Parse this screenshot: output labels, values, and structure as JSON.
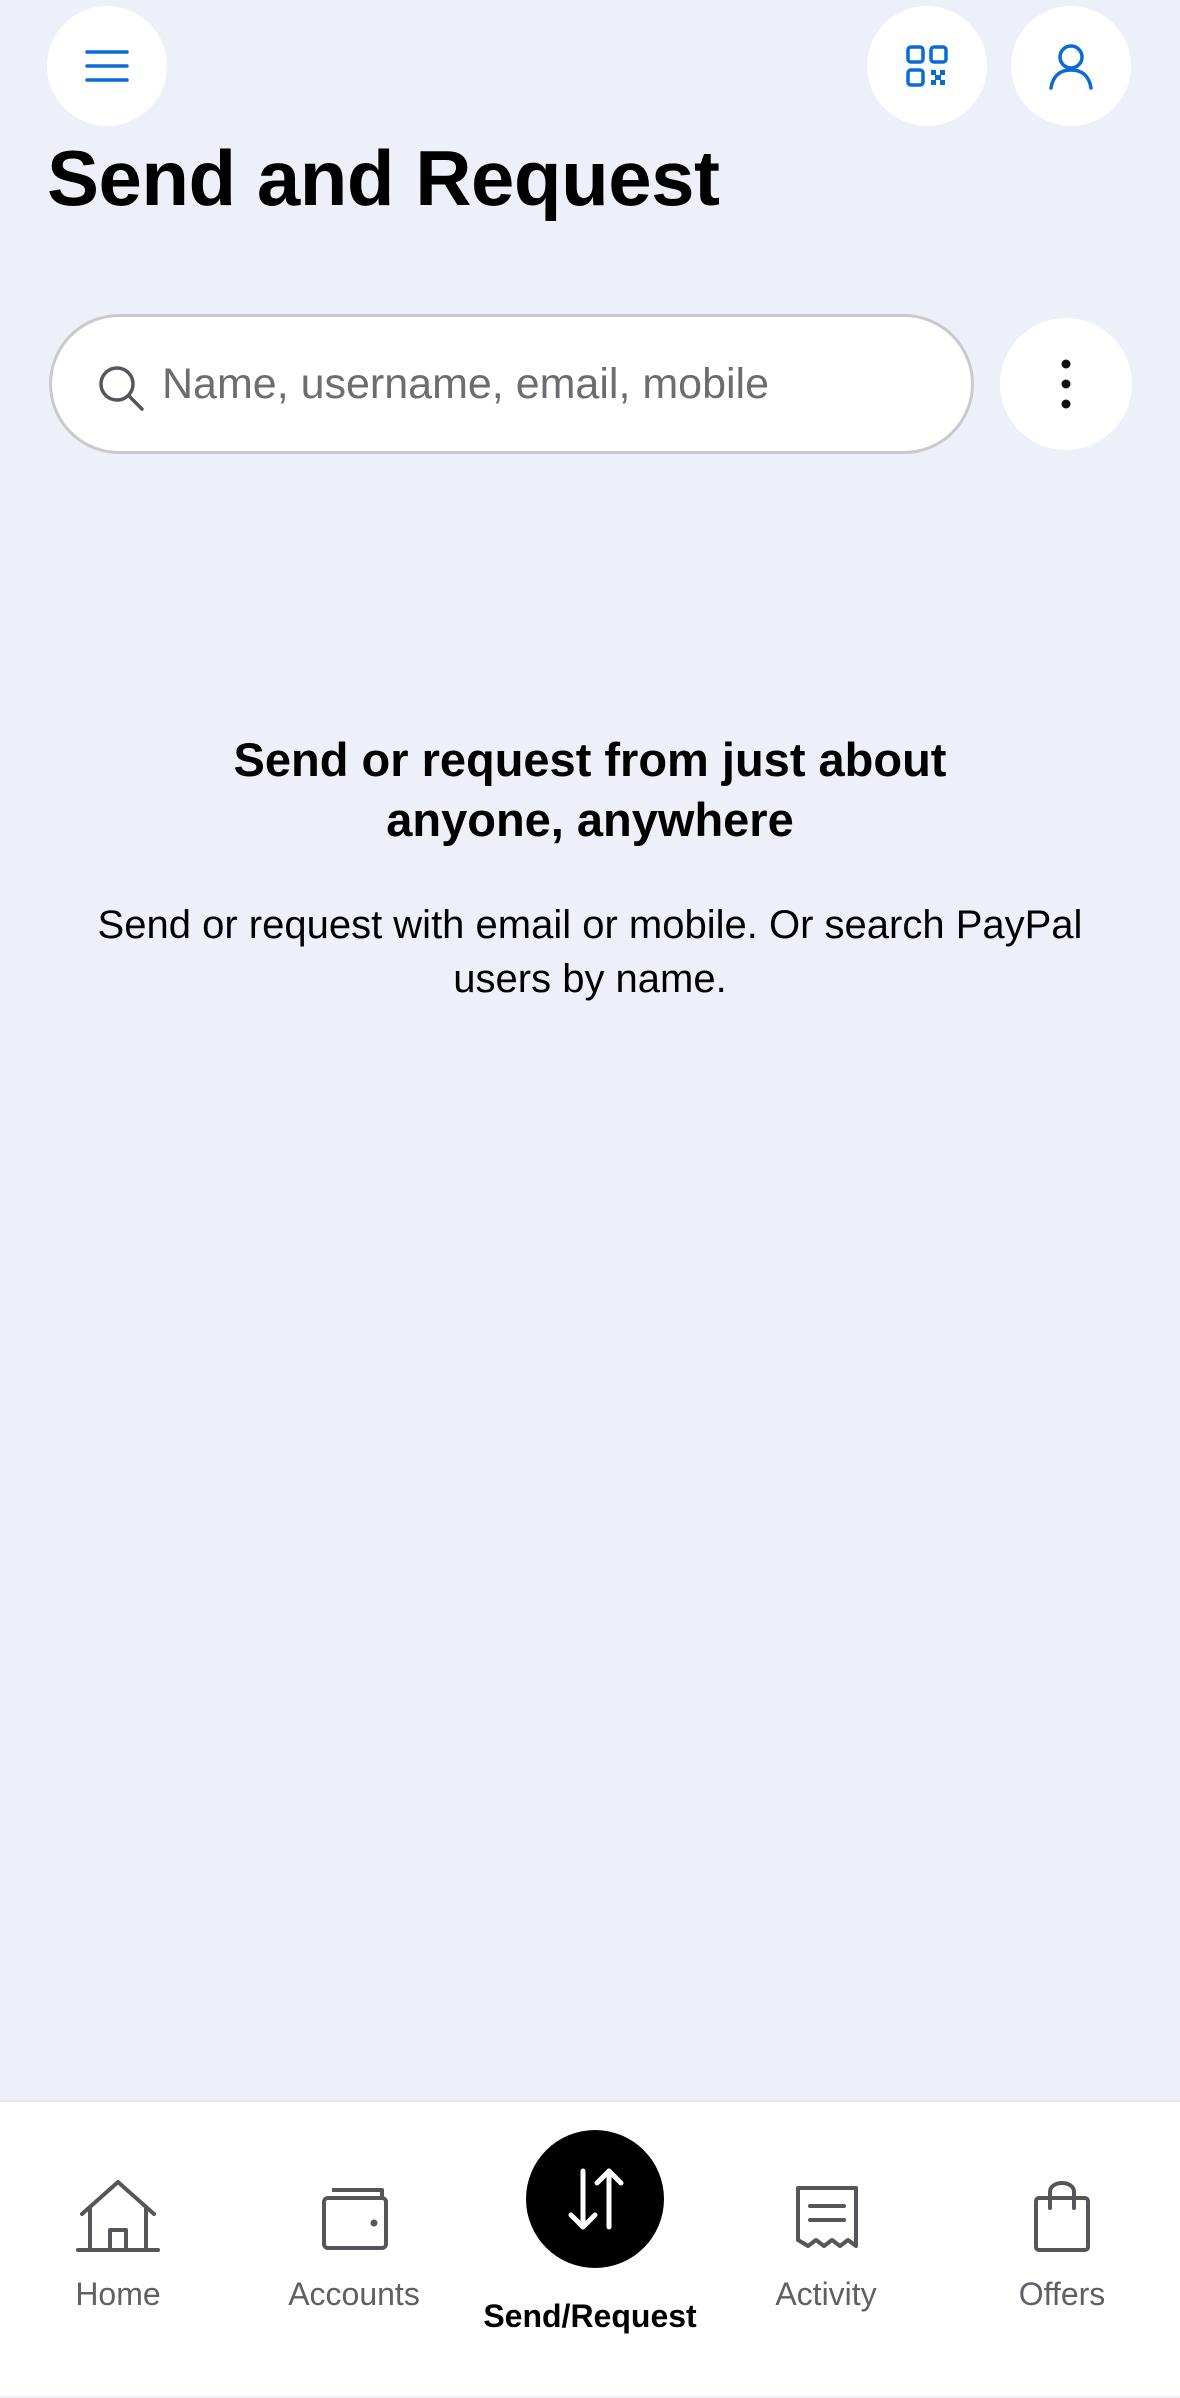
{
  "header": {
    "title": "Send and Request",
    "menu_icon": "hamburger-menu-icon",
    "qr_icon": "qr-code-icon",
    "profile_icon": "user-profile-icon"
  },
  "search": {
    "placeholder": "Name, username, email, mobile",
    "value": "",
    "icon": "search-icon"
  },
  "more_options_icon": "vertical-dots-icon",
  "empty_state": {
    "heading": "Send or request from just about anyone, anywhere",
    "body": "Send or request with email or mobile. Or search PayPal users by name."
  },
  "bottom_nav": {
    "items": [
      {
        "label": "Home",
        "icon": "home-icon",
        "active": false
      },
      {
        "label": "Accounts",
        "icon": "wallet-icon",
        "active": false
      },
      {
        "label": "Send/Request",
        "icon": "transfer-arrows-icon",
        "active": true
      },
      {
        "label": "Activity",
        "icon": "receipt-icon",
        "active": false
      },
      {
        "label": "Offers",
        "icon": "shopping-bag-icon",
        "active": false
      }
    ]
  },
  "colors": {
    "background": "#eef0f9",
    "accent_blue": "#0a6bd6",
    "active_nav": "#000000",
    "inactive_nav": "#5f5f66"
  }
}
